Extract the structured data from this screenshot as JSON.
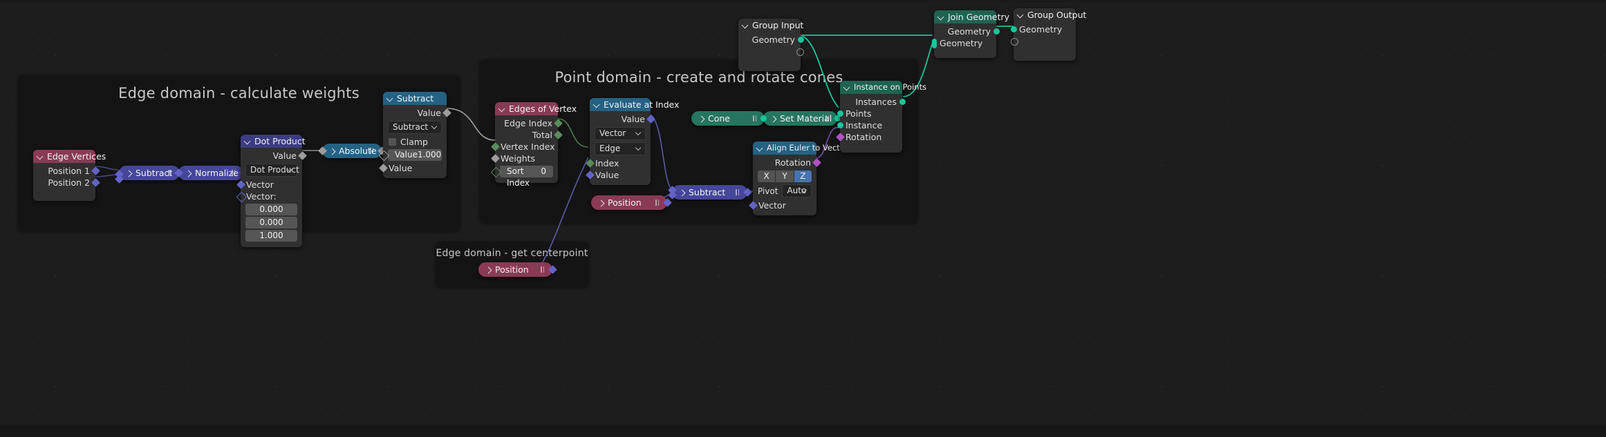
{
  "editor": {
    "name": "blender-geometry-node-editor",
    "background": "#1d1d1d",
    "frame_bg": "#141414"
  },
  "colors": {
    "header_input": "#8a3a55",
    "header_converter": "#246283",
    "header_vector": "#3c3c83",
    "header_geometry": "#1f6351",
    "node_body": "#303030",
    "socket_vector": "#6363c7",
    "socket_geometry": "#00d6a3",
    "socket_float": "#a1a1a1",
    "socket_int": "#598c5c",
    "socket_rotation": "#c044cf",
    "pill_input": "#8a3a55",
    "pill_converter": "#246283",
    "pill_vector": "#46469a",
    "pill_geometry": "#25755f",
    "axis_active": "#4772b3"
  },
  "frames": [
    {
      "label": "Edge domain - calculate weights"
    },
    {
      "label": "Point domain - create and rotate cones"
    },
    {
      "label": "Edge domain - get centerpoint"
    }
  ],
  "nodes": {
    "edge_vertices": {
      "title": "Edge Vertices",
      "outputs": [
        {
          "label": "Position 1"
        },
        {
          "label": "Position 2"
        }
      ]
    },
    "subtract_vec_1": {
      "title": "Subtract"
    },
    "normalize": {
      "title": "Normalize"
    },
    "dot_product": {
      "title": "Dot Product",
      "outputs": [
        {
          "label": "Value"
        }
      ],
      "operation": "Dot Product",
      "inputs": [
        {
          "label": "Vector"
        },
        {
          "label": "Vector:"
        }
      ],
      "vector_values": [
        "0.000",
        "0.000",
        "1.000"
      ]
    },
    "absolute": {
      "title": "Absolute"
    },
    "subtract_math": {
      "title": "Subtract",
      "outputs": [
        {
          "label": "Value"
        }
      ],
      "operation": "Subtract",
      "clamp_label": "Clamp",
      "value_label": "Value",
      "value": "1.000",
      "input_label": "Value"
    },
    "edges_of_vertex": {
      "title": "Edges of Vertex",
      "outputs": [
        {
          "label": "Edge Index"
        },
        {
          "label": "Total"
        }
      ],
      "inputs": [
        {
          "label": "Vertex Index"
        },
        {
          "label": "Weights"
        }
      ],
      "sort_index_label": "Sort Index",
      "sort_index_value": "0"
    },
    "evaluate_at_index": {
      "title": "Evaluate at Index",
      "outputs": [
        {
          "label": "Value"
        }
      ],
      "data_type": "Vector",
      "domain": "Edge",
      "inputs": [
        {
          "label": "Index"
        },
        {
          "label": "Value"
        }
      ]
    },
    "position_mid": {
      "title": "Position"
    },
    "subtract_vec_2": {
      "title": "Subtract"
    },
    "cone": {
      "title": "Cone"
    },
    "set_material": {
      "title": "Set Material"
    },
    "align_euler": {
      "title": "Align Euler to Vector",
      "outputs": [
        {
          "label": "Rotation"
        }
      ],
      "axes": [
        "X",
        "Y",
        "Z"
      ],
      "axis_active": "Z",
      "pivot_label": "Pivot",
      "pivot_value": "Auto",
      "inputs": [
        {
          "label": "Vector"
        }
      ]
    },
    "instance_on_points": {
      "title": "Instance on Points",
      "outputs": [
        {
          "label": "Instances"
        }
      ],
      "inputs": [
        {
          "label": "Points"
        },
        {
          "label": "Instance"
        },
        {
          "label": "Rotation"
        }
      ]
    },
    "group_input": {
      "title": "Group Input",
      "outputs": [
        {
          "label": "Geometry"
        },
        {
          "label": ""
        }
      ]
    },
    "join_geometry": {
      "title": "Join Geometry",
      "outputs": [
        {
          "label": "Geometry"
        }
      ],
      "inputs": [
        {
          "label": "Geometry"
        }
      ]
    },
    "group_output": {
      "title": "Group Output",
      "inputs": [
        {
          "label": "Geometry"
        },
        {
          "label": ""
        }
      ]
    },
    "position_bottom": {
      "title": "Position"
    }
  }
}
